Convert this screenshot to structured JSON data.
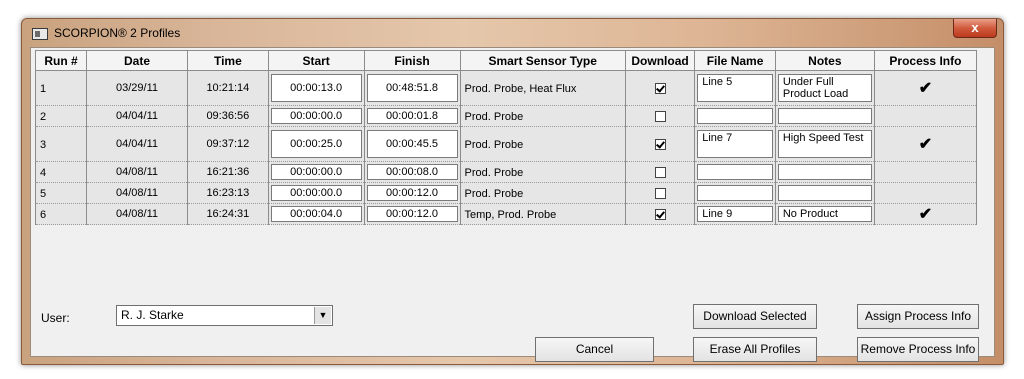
{
  "window": {
    "title": "SCORPION® 2 Profiles",
    "close_label": "x"
  },
  "columns": [
    "Run #",
    "Date",
    "Time",
    "Start",
    "Finish",
    "Smart Sensor Type",
    "Download",
    "File Name",
    "Notes",
    "Process Info"
  ],
  "rows": [
    {
      "run": "1",
      "date": "03/29/11",
      "time": "10:21:14",
      "start": "00:00:13.0",
      "finish": "00:48:51.8",
      "sensor": "Prod. Probe, Heat Flux",
      "download": true,
      "file": "Line 5",
      "notes": "Under Full Product Load",
      "process": "✔"
    },
    {
      "run": "2",
      "date": "04/04/11",
      "time": "09:36:56",
      "start": "00:00:00.0",
      "finish": "00:00:01.8",
      "sensor": "Prod. Probe",
      "download": false,
      "file": "",
      "notes": "",
      "process": ""
    },
    {
      "run": "3",
      "date": "04/04/11",
      "time": "09:37:12",
      "start": "00:00:25.0",
      "finish": "00:00:45.5",
      "sensor": "Prod. Probe",
      "download": true,
      "file": "Line 7",
      "notes": "High Speed Test",
      "process": "✔"
    },
    {
      "run": "4",
      "date": "04/08/11",
      "time": "16:21:36",
      "start": "00:00:00.0",
      "finish": "00:00:08.0",
      "sensor": "Prod. Probe",
      "download": false,
      "file": "",
      "notes": "",
      "process": ""
    },
    {
      "run": "5",
      "date": "04/08/11",
      "time": "16:23:13",
      "start": "00:00:00.0",
      "finish": "00:00:12.0",
      "sensor": "Prod. Probe",
      "download": false,
      "file": "",
      "notes": "",
      "process": ""
    },
    {
      "run": "6",
      "date": "04/08/11",
      "time": "16:24:31",
      "start": "00:00:04.0",
      "finish": "00:00:12.0",
      "sensor": "Temp, Prod. Probe",
      "download": true,
      "file": "Line 9",
      "notes": "No Product",
      "process": "✔"
    }
  ],
  "user": {
    "label": "User:",
    "value": "R. J. Starke"
  },
  "buttons": {
    "download_selected": "Download Selected",
    "assign_process_info": "Assign Process Info",
    "cancel": "Cancel",
    "erase_all_profiles": "Erase All Profiles",
    "remove_process_info": "Remove Process Info"
  }
}
